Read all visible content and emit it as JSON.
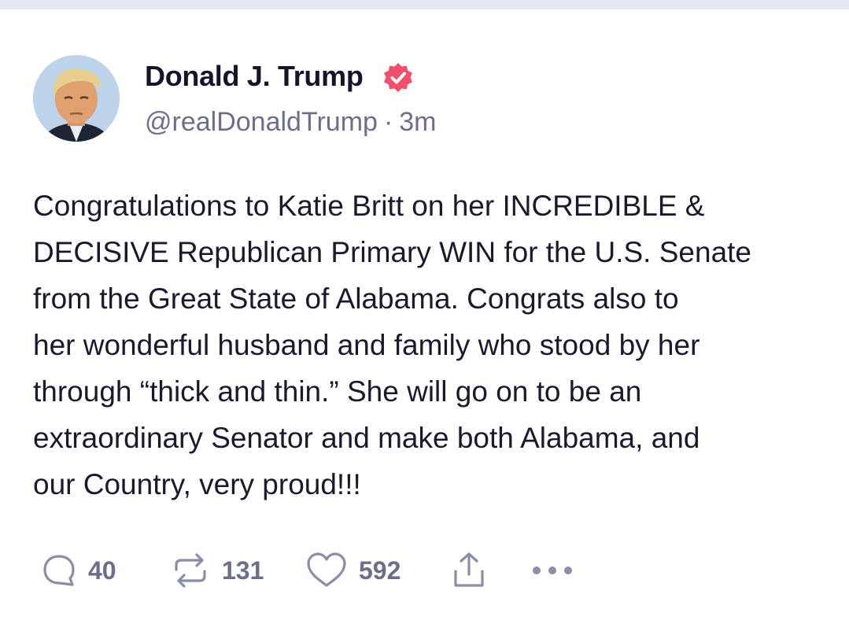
{
  "post": {
    "author": {
      "display_name": "Donald J. Trump",
      "handle": "@realDonaldTrump",
      "verified": true,
      "avatar": "profile-photo"
    },
    "separator": "·",
    "time": "3m",
    "text": "Congratulations to Katie Britt on her INCREDIBLE &\nDECISIVE Republican Primary WIN for the U.S. Senate\nfrom the Great State of Alabama. Congrats also to\nher wonderful husband and family who stood by her\nthrough “thick and thin.” She will go on to be an\nextraordinary Senator and make both Alabama, and\nour Country, very proud!!!",
    "actions": {
      "replies": "40",
      "reposts": "131",
      "likes": "592"
    }
  },
  "icons": {
    "verified": "verified-badge-icon",
    "reply": "speech-bubble-icon",
    "repost": "repost-arrows-icon",
    "like": "heart-icon",
    "share": "share-upload-icon",
    "more": "ellipsis-icon"
  },
  "colors": {
    "verified_badge": "#f0506e",
    "text": "#1a1a2e",
    "muted": "#6b6f8a",
    "icon": "#8a8ea8"
  }
}
